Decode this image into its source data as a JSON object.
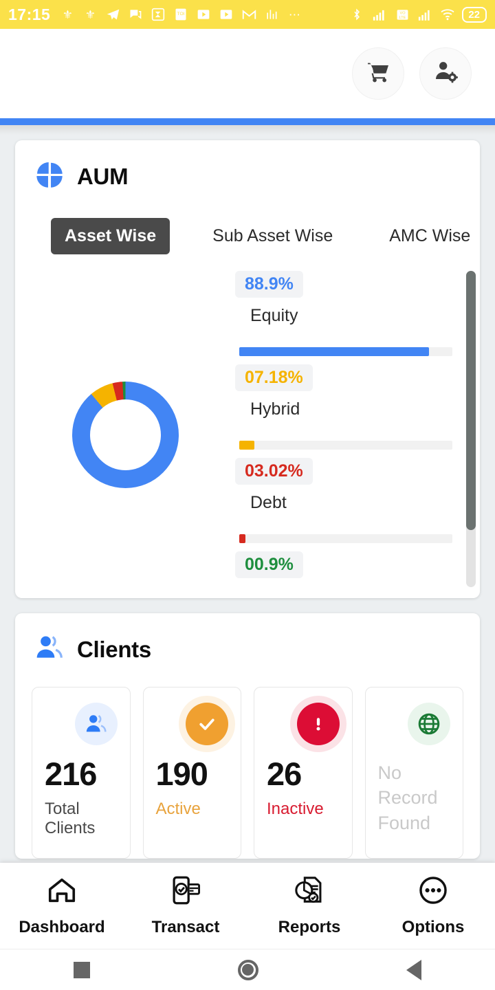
{
  "status_bar": {
    "time": "17:15",
    "battery": "22",
    "icons": [
      "butterfly-icon",
      "butterfly-icon",
      "telegram-icon",
      "chat-icon",
      "s-app-icon",
      "toi-news-icon",
      "play-video-icon",
      "play-video-icon",
      "gmail-icon",
      "stocks-icon",
      "more-dots-icon",
      "bluetooth-icon",
      "signal-icon",
      "volte-icon",
      "signal-icon",
      "wifi-icon"
    ],
    "background": "#FBE14A"
  },
  "appbar": {
    "cart_label": "cart-icon",
    "profile_label": "user-settings-icon",
    "accent": "#4285F4"
  },
  "aum": {
    "title": "AUM",
    "tabs": [
      {
        "label": "Asset Wise",
        "active": true
      },
      {
        "label": "Sub Asset Wise",
        "active": false
      },
      {
        "label": "AMC Wise",
        "active": false
      }
    ]
  },
  "chart_data": {
    "type": "pie",
    "title": "AUM",
    "subtitle": "Asset Wise",
    "legend_position": "right",
    "categories": [
      "Equity",
      "Hybrid",
      "Debt",
      ""
    ],
    "values": [
      88.9,
      7.18,
      3.02,
      0.9
    ],
    "labels": [
      "88.9%",
      "07.18%",
      "03.02%",
      "00.9%"
    ],
    "colors": [
      "#4285F4",
      "#F5B300",
      "#D62A1F",
      "#1E8E3E"
    ],
    "ylim": [
      0,
      100
    ],
    "grid": false
  },
  "clients": {
    "title": "Clients",
    "cards": [
      {
        "value": "216",
        "label": "Total Clients",
        "icon": "people-icon",
        "color": "#3d3d3d",
        "icon_color": "#2e7cf6",
        "icon_bg": "#e8f0fe"
      },
      {
        "value": "190",
        "label": "Active",
        "icon": "check-circle-icon",
        "color": "#E8A33D",
        "icon_color": "#ffffff",
        "icon_bg": "#F0A030"
      },
      {
        "value": "26",
        "label": "Inactive",
        "icon": "alert-circle-icon",
        "color": "#D81B30",
        "icon_color": "#ffffff",
        "icon_bg": "#DC0D35"
      },
      {
        "value": "",
        "label": "No Record Found",
        "icon": "globe-icon",
        "color": "#c9c9c9",
        "icon_color": "#1B7A35",
        "icon_bg": "#e9f5ec"
      }
    ]
  },
  "bottom_nav": [
    {
      "label": "Dashboard",
      "icon": "home-icon"
    },
    {
      "label": "Transact",
      "icon": "phone-card-icon"
    },
    {
      "label": "Reports",
      "icon": "report-chart-icon"
    },
    {
      "label": "Options",
      "icon": "more-circle-icon"
    }
  ],
  "system_nav": [
    {
      "name": "recents-button"
    },
    {
      "name": "home-button"
    },
    {
      "name": "back-button"
    }
  ]
}
